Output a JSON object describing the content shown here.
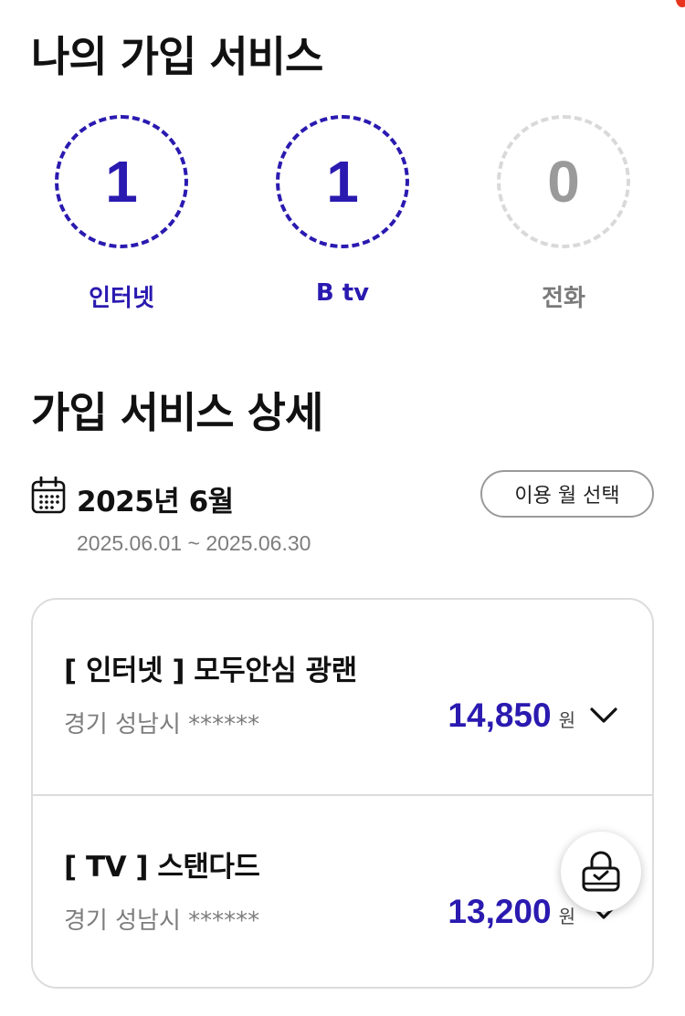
{
  "my_services": {
    "title": "나의 가입 서비스",
    "counters": [
      {
        "label": "인터넷",
        "count": "1"
      },
      {
        "label": "B tv",
        "count": "1"
      },
      {
        "label": "전화",
        "count": "0"
      }
    ]
  },
  "detail": {
    "title": "가입 서비스 상세",
    "month_label": "2025년 6월",
    "month_select_label": "이용 월 선택",
    "date_range": "2025.06.01 ~ 2025.06.30",
    "services": [
      {
        "name": "[ 인터넷 ] 모두안심 광랜",
        "address": "경기 성남시 ******",
        "price": "14,850",
        "unit": "원"
      },
      {
        "name": "[ TV ] 스탠다드",
        "address": "경기 성남시 ******",
        "price": "13,200",
        "unit": "원"
      }
    ]
  },
  "icons": {
    "calendar": "calendar-icon",
    "expand": "chevron-down-icon",
    "secure": "lock-check-icon"
  },
  "colors": {
    "accent": "#2a1ab0",
    "inactive": "#9a9a9a",
    "alert_dot": "#e8341c"
  }
}
